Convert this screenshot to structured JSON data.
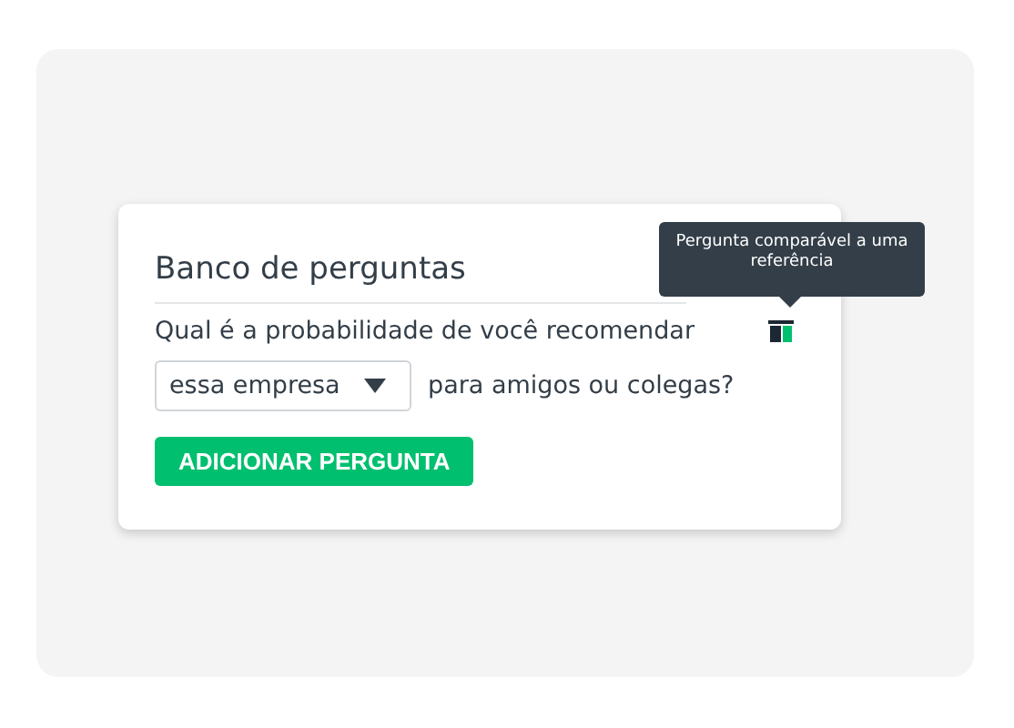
{
  "card": {
    "title": "Banco de perguntas",
    "question_start": "Qual é a probabilidade de você recomendar",
    "dropdown": {
      "value": "essa empresa"
    },
    "question_end": "para amigos ou colegas?",
    "button": "ADICIONAR PERGUNTA"
  },
  "tooltip": {
    "text": "Pergunta comparável a uma referência"
  }
}
